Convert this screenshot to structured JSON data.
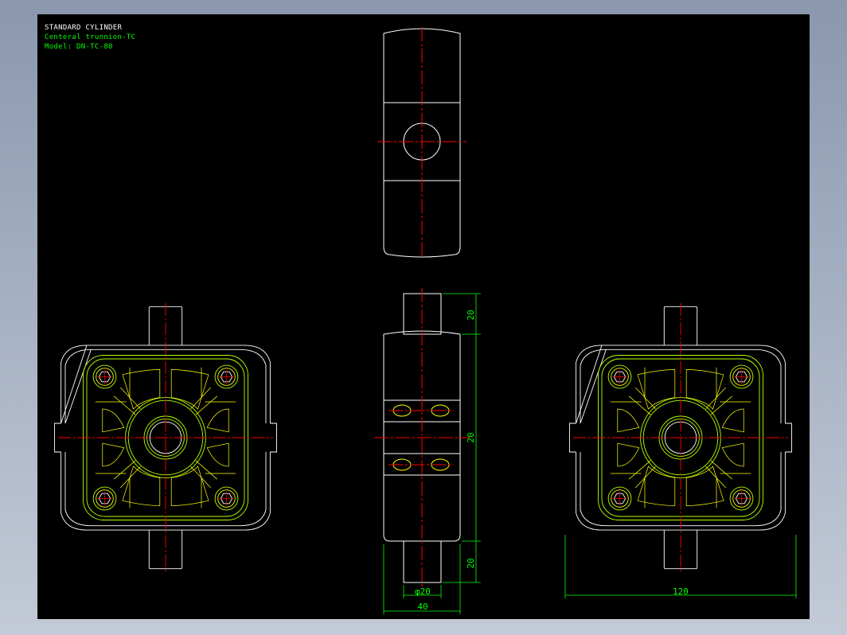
{
  "title_block": {
    "line1": "STANDARD CYLINDER",
    "line2": "Centeral trunnion-TC",
    "line3": "Model: DN-TC-80"
  },
  "dimensions": {
    "top_stub": "20",
    "body_height": "20",
    "bottom_stub": "20",
    "pin_diameter": "φ20",
    "body_width": "40",
    "flange_width": "120"
  },
  "colors": {
    "background": "#000000",
    "outline": "#ffffff",
    "center_line": "#ff0000",
    "flange": "#b5ff00",
    "detail": "#ffff00",
    "dimension": "#00ff00"
  }
}
